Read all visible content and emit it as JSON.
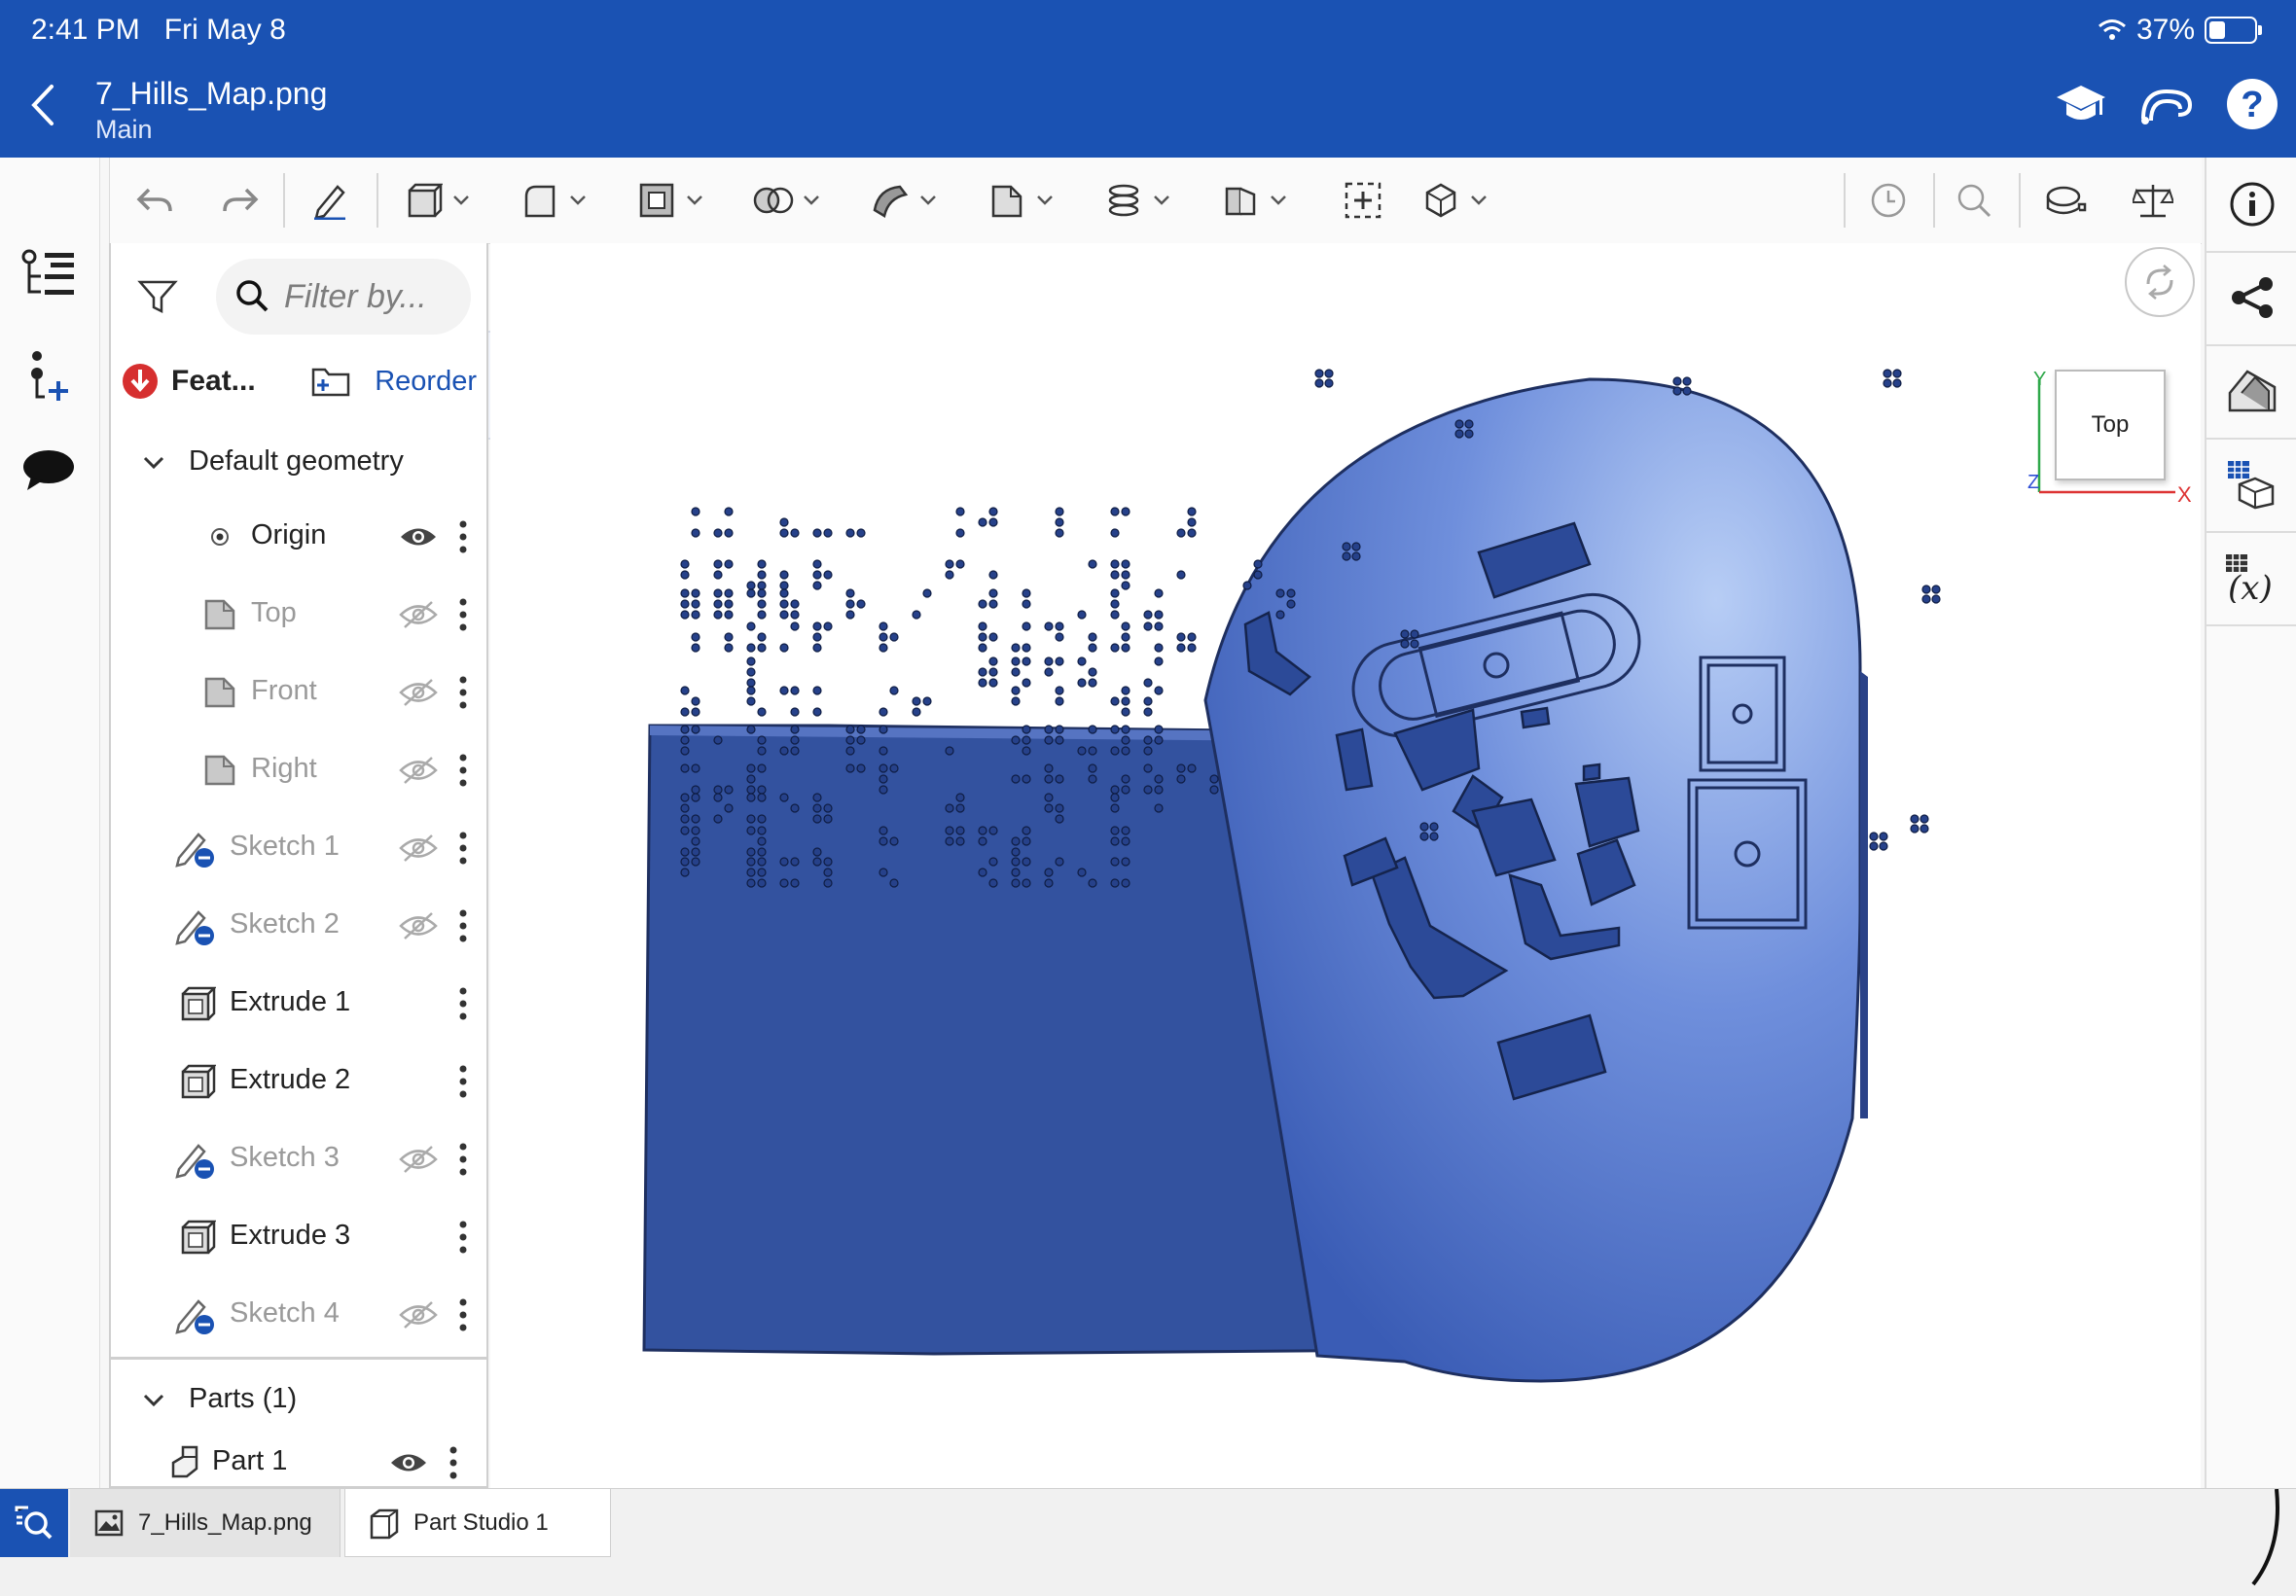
{
  "status": {
    "time": "2:41 PM",
    "date": "Fri May 8",
    "battery_text": "37%",
    "battery_level": 0.37
  },
  "header": {
    "title": "7_Hills_Map.png",
    "subtitle": "Main",
    "icons": [
      "learning-center-icon",
      "app-store-icon",
      "help-icon"
    ]
  },
  "left_rail": {
    "icons": [
      "feature-list-icon",
      "insert-feature-icon",
      "comments-icon"
    ]
  },
  "toolbar": {
    "tools": [
      "undo-icon",
      "redo-icon",
      "sketch-icon",
      "extrude-icon",
      "fillet-icon",
      "shell-icon",
      "boolean-icon",
      "sweep-icon",
      "plane-icon",
      "helix-icon",
      "mirror-icon",
      "mate-connector-icon",
      "cube-icon",
      "history-icon",
      "search-icon",
      "measure-icon",
      "mass-properties-icon"
    ]
  },
  "feature_panel": {
    "search_placeholder": "Filter by...",
    "features_label": "Feat...",
    "reorder_label": "Reorder",
    "default_geometry_label": "Default geometry",
    "items": [
      {
        "label": "Origin",
        "type": "origin",
        "visible": true
      },
      {
        "label": "Top",
        "type": "plane",
        "visible": false
      },
      {
        "label": "Front",
        "type": "plane",
        "visible": false
      },
      {
        "label": "Right",
        "type": "plane",
        "visible": false
      },
      {
        "label": "Sketch 1",
        "type": "sketch",
        "visible": false
      },
      {
        "label": "Sketch 2",
        "type": "sketch",
        "visible": false
      },
      {
        "label": "Extrude 1",
        "type": "extrude",
        "visible": true
      },
      {
        "label": "Extrude 2",
        "type": "extrude",
        "visible": true
      },
      {
        "label": "Sketch 3",
        "type": "sketch",
        "visible": false
      },
      {
        "label": "Extrude 3",
        "type": "extrude",
        "visible": true
      },
      {
        "label": "Sketch 4",
        "type": "sketch",
        "visible": false
      }
    ],
    "parts_label": "Parts (1)",
    "part_label": "Part 1"
  },
  "viewport": {
    "viewcube_face": "Top",
    "axis_labels": {
      "y": "Y",
      "x": "X",
      "z": "Z"
    },
    "model_color": "#3f63b8"
  },
  "right_rail": {
    "icons": [
      "info-icon",
      "share-icon",
      "appearance-icon",
      "configurations-icon",
      "variables-icon"
    ]
  },
  "bottom_tabs": {
    "tab1": "7_Hills_Map.png",
    "tab2": "Part Studio 1"
  }
}
